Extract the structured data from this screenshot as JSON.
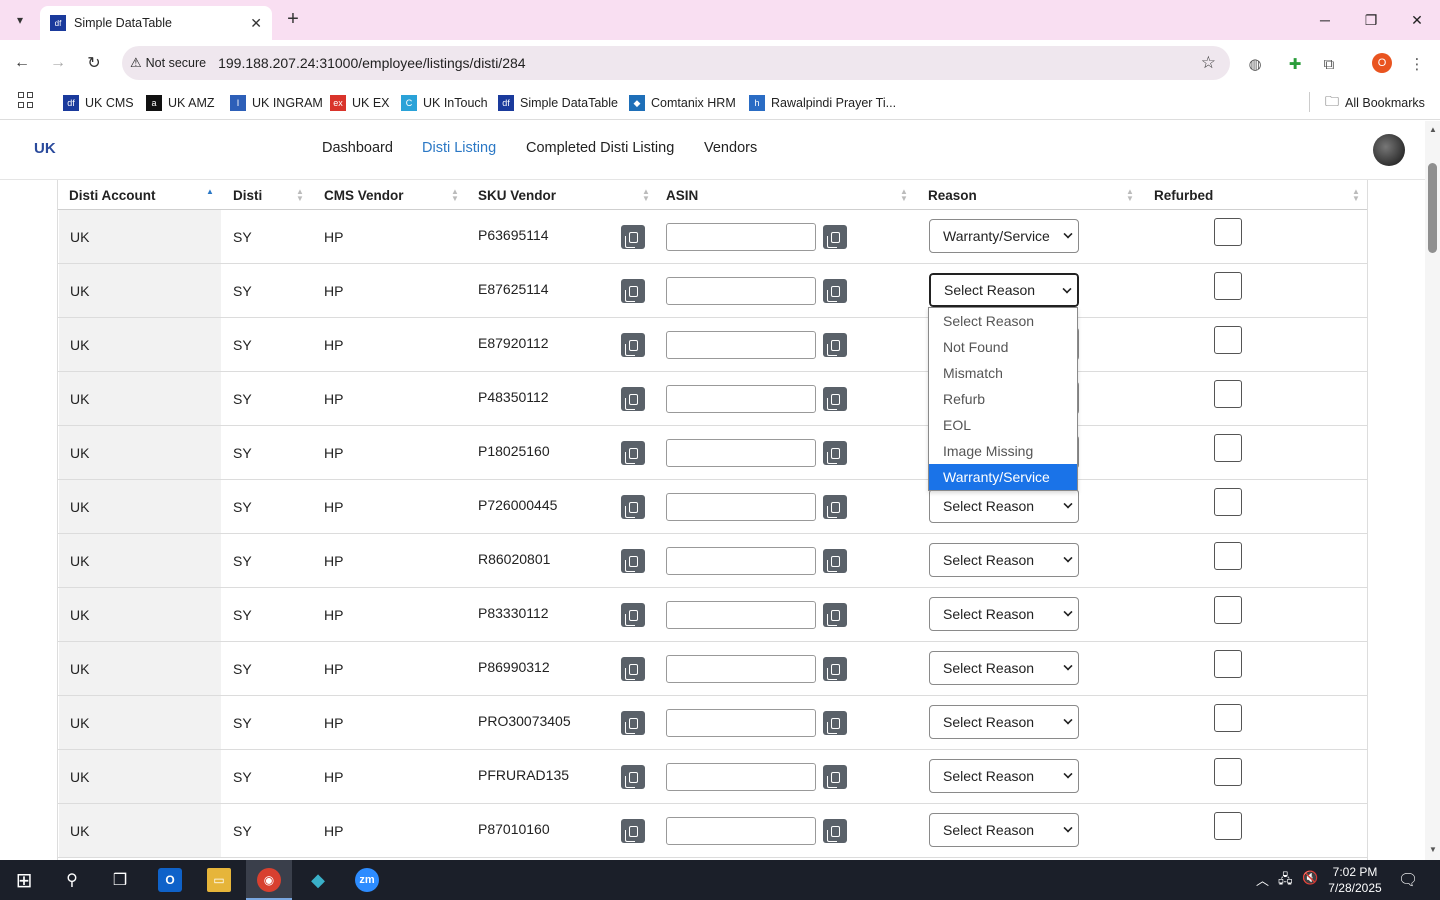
{
  "browser": {
    "tab_title": "Simple DataTable",
    "tab_favicon_text": "df",
    "security_label": "Not secure",
    "url": "199.188.207.24:31000/employee/listings/disti/284",
    "profile_initial": "O",
    "bookmarks": [
      {
        "label": "UK CMS",
        "icon": "df",
        "color": "#1a3a9c"
      },
      {
        "label": "UK AMZ",
        "icon": "a",
        "color": "#111111"
      },
      {
        "label": "UK INGRAM",
        "icon": "I",
        "color": "#2d5fb8"
      },
      {
        "label": "UK EX",
        "icon": "ex",
        "color": "#d9342b"
      },
      {
        "label": "UK InTouch",
        "icon": "C",
        "color": "#2aa2d8"
      },
      {
        "label": "Simple DataTable",
        "icon": "df",
        "color": "#1a3a9c"
      },
      {
        "label": "Comtanix HRM",
        "icon": "◆",
        "color": "#1e6fb8"
      },
      {
        "label": "Rawalpindi Prayer Ti...",
        "icon": "h",
        "color": "#2a6cc4"
      }
    ],
    "all_bookmarks": "All Bookmarks"
  },
  "app": {
    "logo_text": "UK",
    "nav": [
      {
        "label": "Dashboard",
        "active": false
      },
      {
        "label": "Disti Listing",
        "active": true
      },
      {
        "label": "Completed Disti Listing",
        "active": false
      },
      {
        "label": "Vendors",
        "active": false
      }
    ]
  },
  "table": {
    "headers": [
      "Disti Account",
      "Disti",
      "CMS Vendor",
      "SKU Vendor",
      "ASIN",
      "Reason",
      "Refurbed"
    ],
    "rows": [
      {
        "account": "UK",
        "disti": "SY",
        "vendor": "HP",
        "sku": "P63695114",
        "reason": "Warranty/Service"
      },
      {
        "account": "UK",
        "disti": "SY",
        "vendor": "HP",
        "sku": "E87625114",
        "reason": "Select Reason"
      },
      {
        "account": "UK",
        "disti": "SY",
        "vendor": "HP",
        "sku": "E87920112",
        "reason": "Select Reason"
      },
      {
        "account": "UK",
        "disti": "SY",
        "vendor": "HP",
        "sku": "P48350112",
        "reason": "Select Reason"
      },
      {
        "account": "UK",
        "disti": "SY",
        "vendor": "HP",
        "sku": "P18025160",
        "reason": "Select Reason"
      },
      {
        "account": "UK",
        "disti": "SY",
        "vendor": "HP",
        "sku": "P726000445",
        "reason": "Select Reason"
      },
      {
        "account": "UK",
        "disti": "SY",
        "vendor": "HP",
        "sku": "R86020801",
        "reason": "Select Reason"
      },
      {
        "account": "UK",
        "disti": "SY",
        "vendor": "HP",
        "sku": "P83330112",
        "reason": "Select Reason"
      },
      {
        "account": "UK",
        "disti": "SY",
        "vendor": "HP",
        "sku": "P86990312",
        "reason": "Select Reason"
      },
      {
        "account": "UK",
        "disti": "SY",
        "vendor": "HP",
        "sku": "PRO30073405",
        "reason": "Select Reason"
      },
      {
        "account": "UK",
        "disti": "SY",
        "vendor": "HP",
        "sku": "PFRURAD135",
        "reason": "Select Reason"
      },
      {
        "account": "UK",
        "disti": "SY",
        "vendor": "HP",
        "sku": "P87010160",
        "reason": "Select Reason"
      }
    ]
  },
  "dropdown": {
    "options": [
      "Select Reason",
      "Not Found",
      "Mismatch",
      "Refurb",
      "EOL",
      "Image Missing",
      "Warranty/Service"
    ],
    "highlighted": "Warranty/Service"
  },
  "taskbar": {
    "time": "7:02 PM",
    "date": "7/28/2025"
  }
}
